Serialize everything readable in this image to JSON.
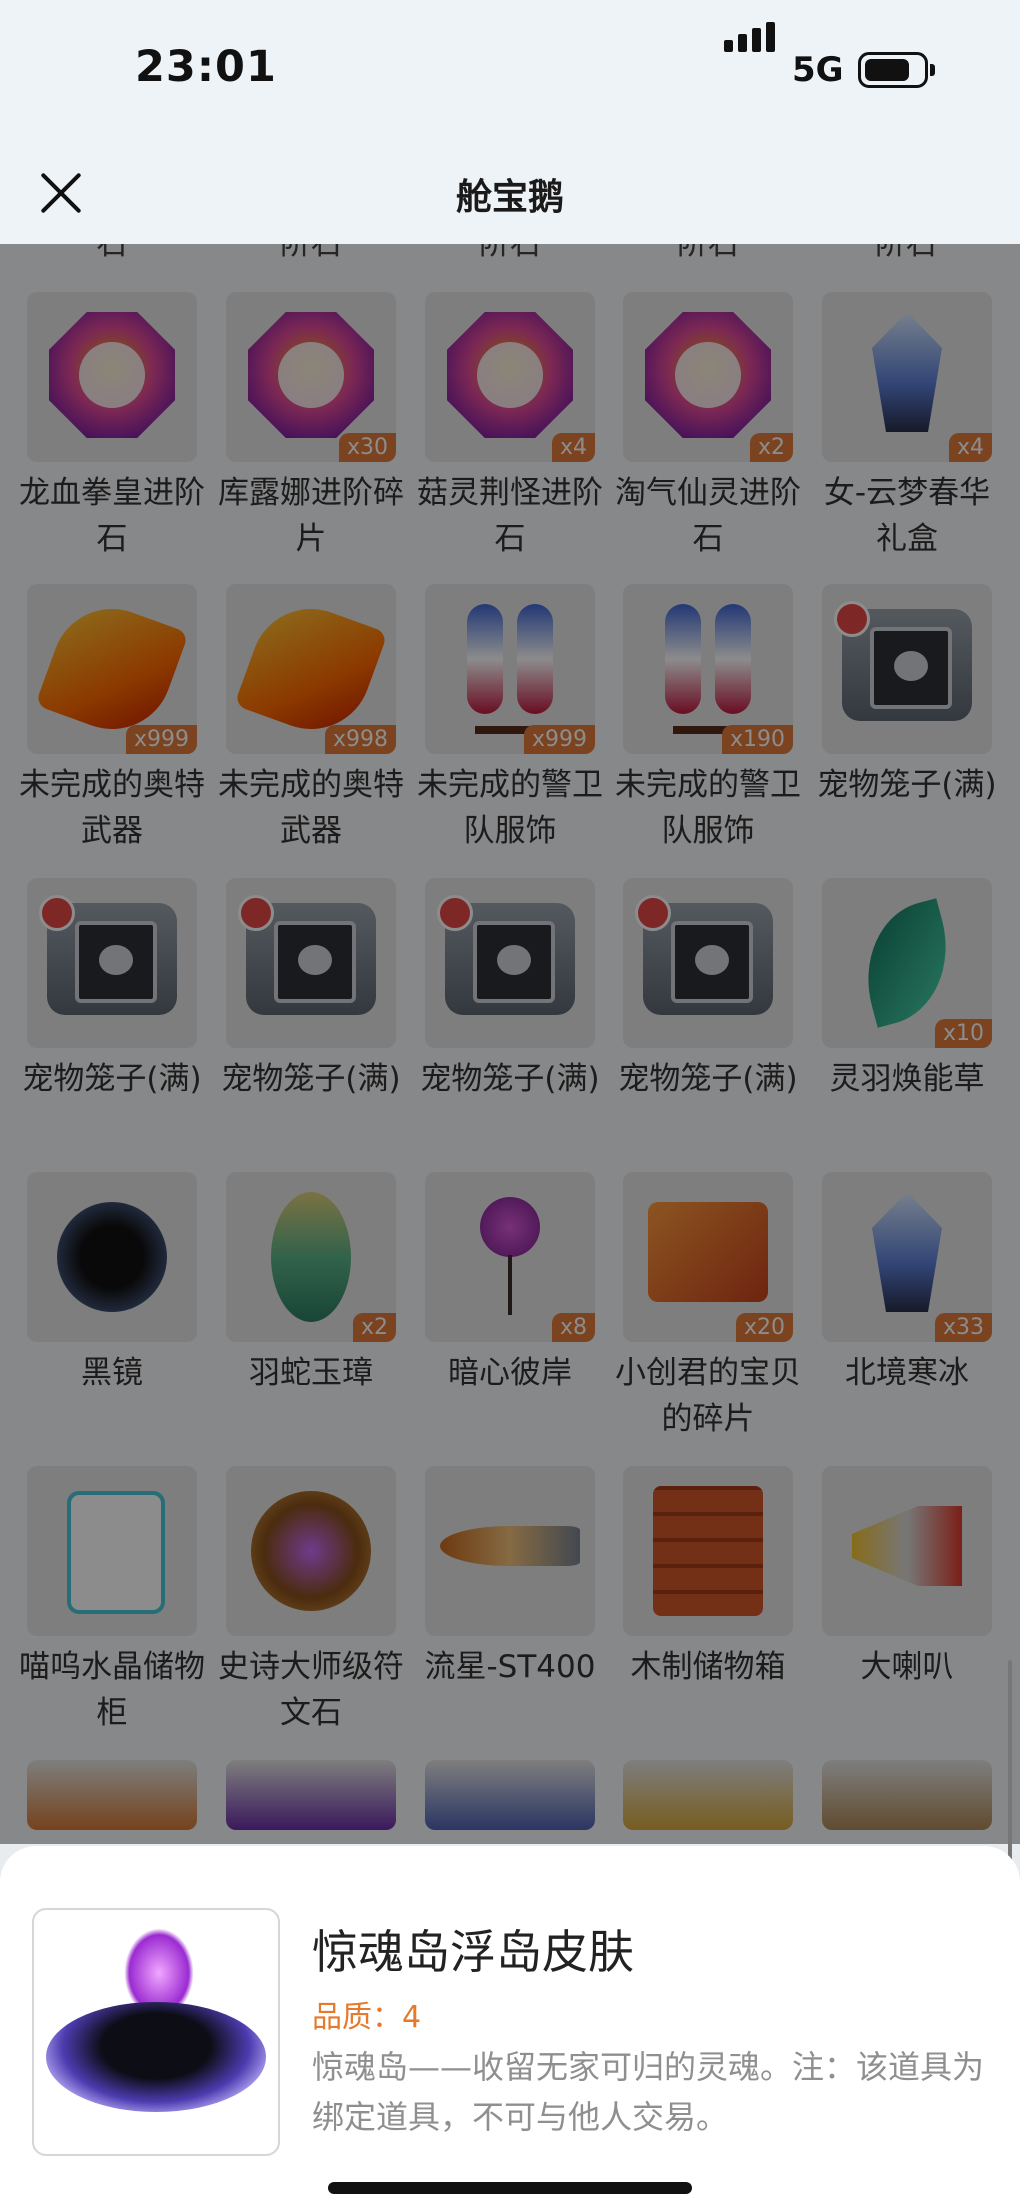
{
  "status_bar": {
    "time": "23:01",
    "network": "5G"
  },
  "nav": {
    "title": "舱宝鹅"
  },
  "partial_top_labels": [
    "石",
    "阶石",
    "阶石",
    "阶石",
    "阶石"
  ],
  "grid": {
    "rows": [
      [
        {
          "name": "龙血拳皇进阶石",
          "count": ""
        },
        {
          "name": "库露娜进阶碎片",
          "count": "x30"
        },
        {
          "name": "菇灵荆怪进阶石",
          "count": "x4"
        },
        {
          "name": "淘气仙灵进阶石",
          "count": "x2"
        },
        {
          "name": "女-云梦春华礼盒",
          "count": "x4"
        }
      ],
      [
        {
          "name": "未完成的奥特武器",
          "count": "x999"
        },
        {
          "name": "未完成的奥特武器",
          "count": "x998"
        },
        {
          "name": "未完成的警卫队服饰",
          "count": "x999"
        },
        {
          "name": "未完成的警卫队服饰",
          "count": "x190"
        },
        {
          "name": "宠物笼子(满)",
          "count": ""
        }
      ],
      [
        {
          "name": "宠物笼子(满)",
          "count": ""
        },
        {
          "name": "宠物笼子(满)",
          "count": ""
        },
        {
          "name": "宠物笼子(满)",
          "count": ""
        },
        {
          "name": "宠物笼子(满)",
          "count": ""
        },
        {
          "name": "灵羽焕能草",
          "count": "x10"
        }
      ],
      [
        {
          "name": "黑镜",
          "count": ""
        },
        {
          "name": "羽蛇玉璋",
          "count": "x2"
        },
        {
          "name": "暗心彼岸",
          "count": "x8"
        },
        {
          "name": "小创君的宝贝的碎片",
          "count": "x20"
        },
        {
          "name": "北境寒冰",
          "count": "x33"
        }
      ],
      [
        {
          "name": "喵呜水晶储物柜",
          "count": ""
        },
        {
          "name": "史诗大师级符文石",
          "count": ""
        },
        {
          "name": "流星-ST400",
          "count": ""
        },
        {
          "name": "木制储物箱",
          "count": ""
        },
        {
          "name": "大喇叭",
          "count": ""
        }
      ]
    ]
  },
  "detail": {
    "title": "惊魂岛浮岛皮肤",
    "quality": "品质：4",
    "description": "惊魂岛——收留无家可归的灵魂。注：该道具为绑定道具，不可与他人交易。"
  }
}
